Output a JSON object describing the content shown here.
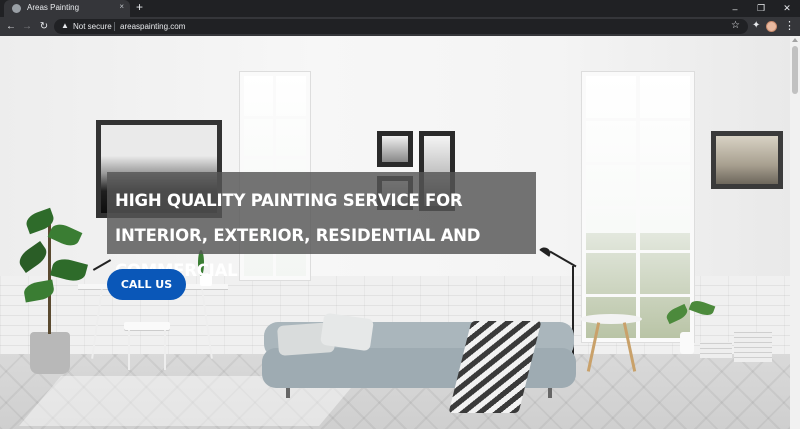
{
  "browser": {
    "tab": {
      "title": "Areas Painting",
      "close": "×"
    },
    "new_tab": "+",
    "window_controls": {
      "minimize": "–",
      "restore": "❐",
      "close": "✕"
    },
    "nav": {
      "back": "←",
      "forward": "→",
      "reload": "↻"
    },
    "omnibox": {
      "warning_icon": "▲",
      "security_label": "Not secure",
      "url": "areaspainting.com"
    },
    "icons": {
      "star": "☆",
      "extensions": "✦",
      "menu": "⋮"
    }
  },
  "hero": {
    "headline": "HIGH QUALITY PAINTING SERVICE FOR INTERIOR, EXTERIOR, RESIDENTIAL AND COMMERCIAL",
    "cta_label": "CALL US"
  },
  "colors": {
    "cta": "#0a57b8",
    "headline_box": "#555555",
    "chrome_dark": "#202124",
    "chrome_toolbar": "#35363a"
  }
}
